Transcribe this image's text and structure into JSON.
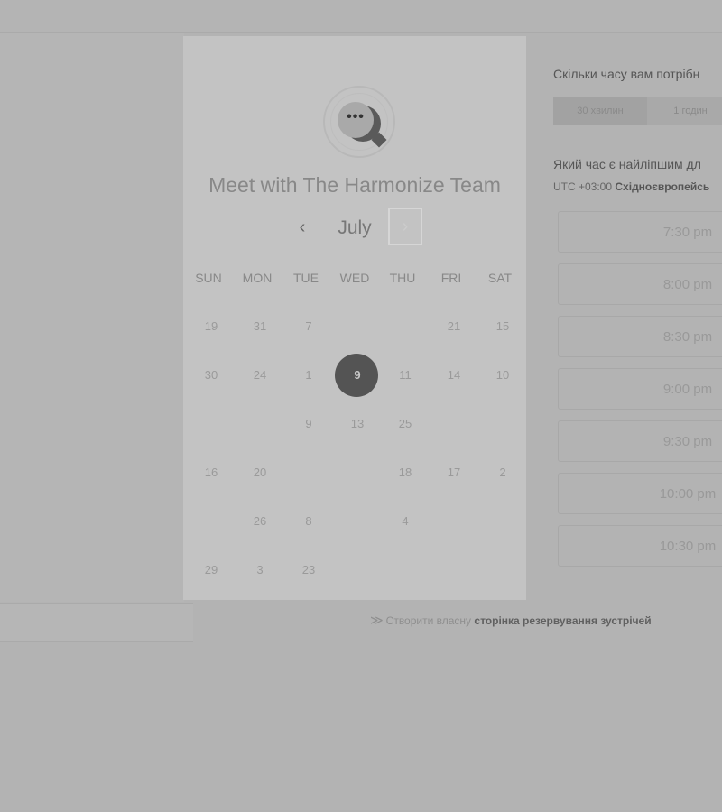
{
  "calendar": {
    "title": "Meet with The Harmonize Team",
    "logo_dots": "•••",
    "month": "July",
    "prev_icon": "‹",
    "next_icon": "›",
    "weekdays": [
      "SUN",
      "MON",
      "TUE",
      "WED",
      "THU",
      "FRI",
      "SAT"
    ],
    "rows": [
      [
        "19",
        "31",
        "7",
        "",
        "",
        "21",
        "15"
      ],
      [
        "30",
        "24",
        "1",
        "9",
        "11",
        "14",
        "10"
      ],
      [
        "",
        "",
        "9",
        "13",
        "25",
        "",
        ""
      ],
      [
        "16",
        "20",
        "",
        "",
        "18",
        "17",
        "2"
      ],
      [
        "",
        "26",
        "8",
        "",
        "4",
        "",
        ""
      ],
      [
        "29",
        "3",
        "23",
        "",
        "",
        "",
        ""
      ]
    ],
    "selected_day": "9"
  },
  "booking": {
    "duration_heading": "Скільки часу вам потрібн",
    "durations": [
      "30 хвилин",
      "1 годин"
    ],
    "time_heading": "Який час є найліпшим дл",
    "timezone_prefix": "UTC +03:00",
    "timezone_name": "Східноєвропейсь",
    "slots": [
      "7:30 pm",
      "8:00 pm",
      "8:30 pm",
      "9:00 pm",
      "9:30 pm",
      "10:00 pm",
      "10:30 pm"
    ]
  },
  "footer": {
    "arrow": "≫",
    "text": "Створити власну",
    "bold": "сторінка резервування зустрічей"
  },
  "colors": {
    "selected_day_bg": "#545454",
    "card_bg": "#c3c3c3",
    "page_bg": "#b3b3b3"
  }
}
